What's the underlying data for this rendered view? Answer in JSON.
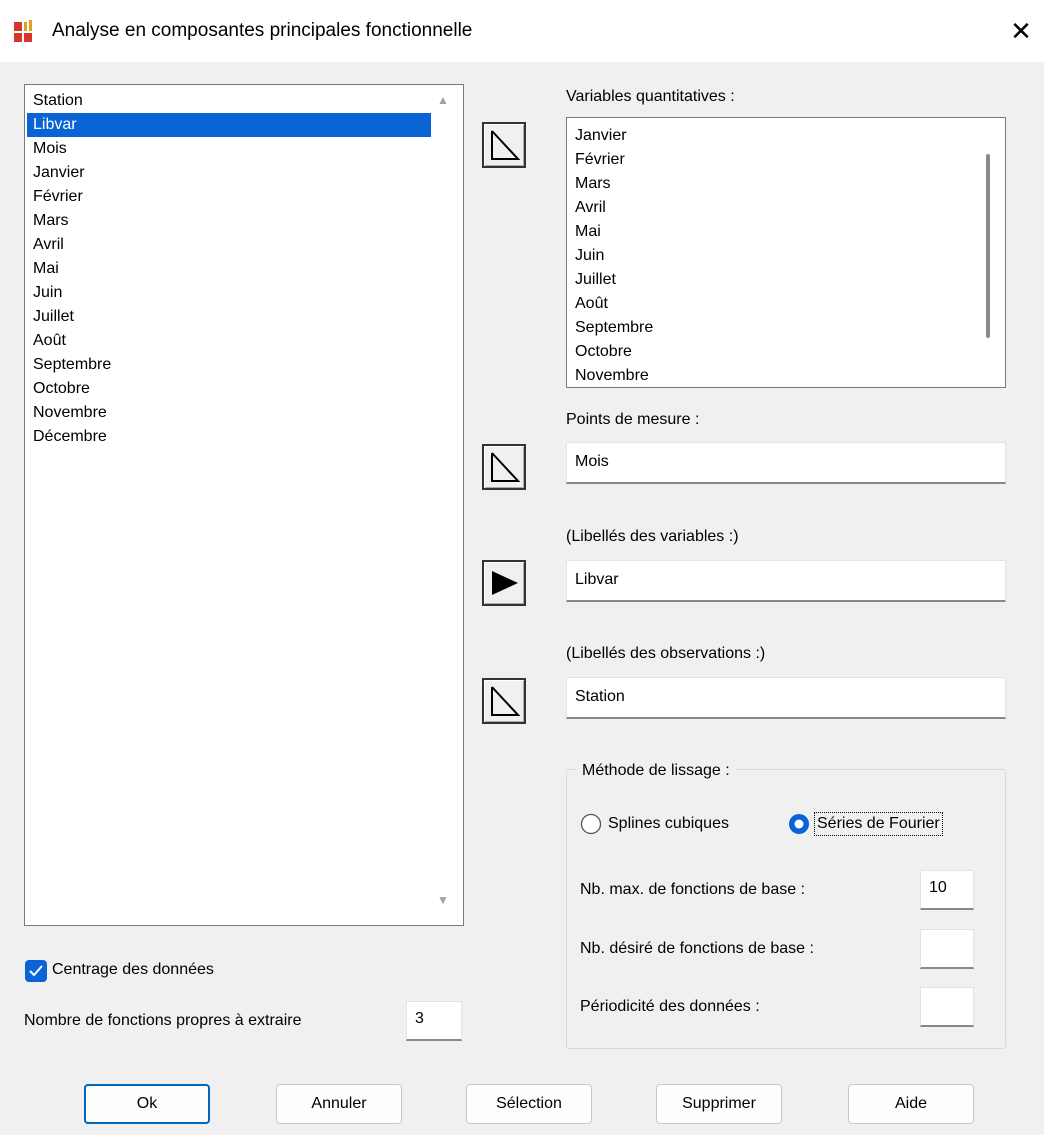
{
  "window": {
    "title": "Analyse en composantes principales fonctionnelle",
    "close_glyph": "✕"
  },
  "source_list": {
    "items": [
      "Station",
      "Libvar",
      "Mois",
      "Janvier",
      "Février",
      "Mars",
      "Avril",
      "Mai",
      "Juin",
      "Juillet",
      "Août",
      "Septembre",
      "Octobre",
      "Novembre",
      "Décembre"
    ],
    "selected": "Libvar"
  },
  "quant_vars": {
    "label": "Variables quantitatives :",
    "items": [
      "Janvier",
      "Février",
      "Mars",
      "Avril",
      "Mai",
      "Juin",
      "Juillet",
      "Août",
      "Septembre",
      "Octobre",
      "Novembre"
    ]
  },
  "points": {
    "label": "Points de mesure :",
    "value": "Mois"
  },
  "var_labels": {
    "label": "(Libellés des variables :)",
    "value": "Libvar"
  },
  "obs_labels": {
    "label": "(Libellés des observations :)",
    "value": "Station"
  },
  "smoothing": {
    "legend": "Méthode de lissage :",
    "option_splines": "Splines cubiques",
    "option_fourier": "Séries de Fourier",
    "selected": "fourier",
    "max_basis_label": "Nb. max. de fonctions de base :",
    "max_basis_value": "10",
    "desired_basis_label": "Nb. désiré de fonctions de base :",
    "desired_basis_value": "",
    "periodicity_label": "Périodicité des données :",
    "periodicity_value": ""
  },
  "centering": {
    "label": "Centrage des données",
    "checked": true
  },
  "eigen": {
    "label": "Nombre de fonctions propres à extraire",
    "value": "3"
  },
  "buttons": {
    "ok": "Ok",
    "cancel": "Annuler",
    "selection": "Sélection",
    "delete": "Supprimer",
    "help": "Aide"
  },
  "colors": {
    "accent": "#0a64d6",
    "background": "#f0f0f0"
  }
}
